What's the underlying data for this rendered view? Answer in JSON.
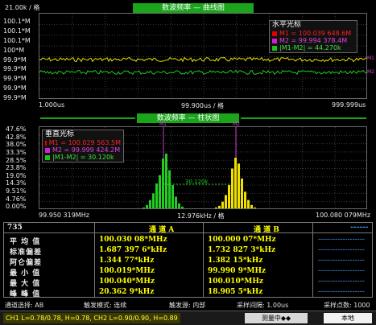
{
  "top_plot": {
    "unit_label": "21.00k / 格",
    "title": "数波频率 — 曲线图",
    "y_labels": [
      "100.1*M",
      "100.1*M",
      "100.1*M",
      "100*M",
      "99.9*M",
      "99.9*M",
      "99.9*M",
      "99.9*M",
      "99.9*M"
    ],
    "x_left": "1.000us",
    "x_mid": "99.900us / 格",
    "x_right": "999.999us",
    "right_marker_a": "M1",
    "right_marker_b": "M2",
    "cursor": {
      "title": "水平光标",
      "m1": "M1 = 100.039 648.6M",
      "m2": "M2 = 99.994 378.4M",
      "diff": "|M1-M2| = 44.270k"
    },
    "trace_a_color": "#e8e000",
    "trace_b_color": "#22cc22"
  },
  "hist_plot": {
    "title": "数波频率 — 柱状图",
    "y_labels": [
      "47.6%",
      "42.8%",
      "38.0%",
      "33.3%",
      "28.5%",
      "23.8%",
      "19.0%",
      "14.3%",
      "9.51%",
      "4.76%",
      "0.00%"
    ],
    "x_left": "99.950 319MHz",
    "x_mid": "12.976kHz / 格",
    "x_right": "100.080 079MHz",
    "top_marker_a": "M1",
    "top_marker_b": "M2",
    "delta_label": "30.120k",
    "cursor": {
      "title": "垂直光标",
      "m1": "M1 = 100.029 563.5M",
      "m2": "M2 = 99.999 424.2M",
      "diff": "|M1-M2| = 30.120k"
    },
    "bars_a_color": "#22cc22",
    "bars_b_color": "#f0e000"
  },
  "stats": {
    "count": "735",
    "channel_a": "通 道 A",
    "channel_b": "通 道 B",
    "channel_c": "------",
    "rows": [
      {
        "label": "平 均 值",
        "a": "100.030 08*MHz",
        "b": "100.000 07*MHz",
        "c": "-------------------"
      },
      {
        "label": "标准偏差",
        "a": "1.687 397 6*kHz",
        "b": "1.732 827 3*kHz",
        "c": "-------------------"
      },
      {
        "label": "阿仑偏差",
        "a": "1.344 77*kHz",
        "b": "1.382 15*kHz",
        "c": "-------------------"
      },
      {
        "label": "最 小 值",
        "a": "100.019*MHz",
        "b": "99.990 9*MHz",
        "c": "-------------------"
      },
      {
        "label": "最 大 值",
        "a": "100.040*MHz",
        "b": "100.010*MHz",
        "c": "-------------------"
      },
      {
        "label": "峰 峰 值",
        "a": "20.362 9*kHz",
        "b": "18.905 5*kHz",
        "c": "-------------------"
      }
    ]
  },
  "status": {
    "channel_select": "通道选择: AB",
    "trigger_mode": "触发模式: 连续",
    "trigger_source": "触发源: 内部",
    "sample_interval": "采样间隔: 1.00us",
    "sample_points": "采样点数: 1000"
  },
  "bottom": {
    "levels": "CH1 L=0.78/0.78, H=0.78, CH2 L=0.90/0.90, H=0.89",
    "measuring": "测量中◆◆",
    "local": "本地"
  }
}
